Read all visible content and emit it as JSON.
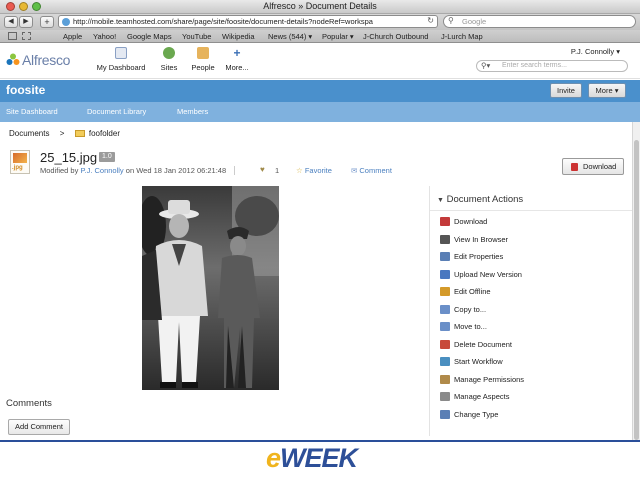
{
  "window": {
    "title": "Alfresco » Document Details"
  },
  "browser": {
    "url": "http://mobile.teamhosted.com/share/page/site/foosite/document-details?nodeRef=workspa",
    "search_placeholder": "Google",
    "bookmarks": [
      "Apple",
      "Yahoo!",
      "Google Maps",
      "YouTube",
      "Wikipedia",
      "News (544) ▾",
      "Popular ▾",
      "J-Church Outbound",
      "J-Lurch Map"
    ]
  },
  "app": {
    "logo_text": "Alfresco",
    "nav": {
      "my_dashboard": "My Dashboard",
      "sites": "Sites",
      "people": "People",
      "more": "More..."
    },
    "user_menu": "P.J. Connolly ▾",
    "search_placeholder": "Enter search terms..."
  },
  "site": {
    "title": "foosite",
    "invite": "Invite",
    "more": "More ▾",
    "tabs": [
      "Site Dashboard",
      "Document Library",
      "Members"
    ]
  },
  "breadcrumb": {
    "root": "Documents",
    "separator": ">",
    "folder": "foofolder"
  },
  "document": {
    "icon_ext": ".jpg",
    "name": "25_15.jpg",
    "version": "1.0",
    "modified_prefix": "Modified by",
    "modified_by": "P.J. Connolly",
    "modified_on": "on Wed 18 Jan 2012 06:21:48",
    "likes": "1",
    "favorite": "Favorite",
    "comment": "Comment",
    "download": "Download"
  },
  "actions": {
    "title": "Document Actions",
    "items": [
      {
        "label": "Download",
        "color": "#c33a3a"
      },
      {
        "label": "View In Browser",
        "color": "#555555"
      },
      {
        "label": "Edit Properties",
        "color": "#5a7fb5"
      },
      {
        "label": "Upload New Version",
        "color": "#4a78c0"
      },
      {
        "label": "Edit Offline",
        "color": "#d49a2a"
      },
      {
        "label": "Copy to...",
        "color": "#6a8fc8"
      },
      {
        "label": "Move to...",
        "color": "#6a8fc8"
      },
      {
        "label": "Delete Document",
        "color": "#c84a3a"
      },
      {
        "label": "Start Workflow",
        "color": "#4a8fc0"
      },
      {
        "label": "Manage Permissions",
        "color": "#b08a4a"
      },
      {
        "label": "Manage Aspects",
        "color": "#8a8a8a"
      },
      {
        "label": "Change Type",
        "color": "#5a7fb5"
      }
    ]
  },
  "comments": {
    "title": "Comments",
    "add_button": "Add Comment"
  },
  "footer": {
    "brand_e": "e",
    "brand_rest": "WEEK"
  },
  "colors": {
    "site_bar": "#4a90cc",
    "site_nav": "#7fb1de",
    "link": "#4a7fbf",
    "brand_blue": "#2d4f98",
    "brand_gold": "#f0b41d"
  }
}
